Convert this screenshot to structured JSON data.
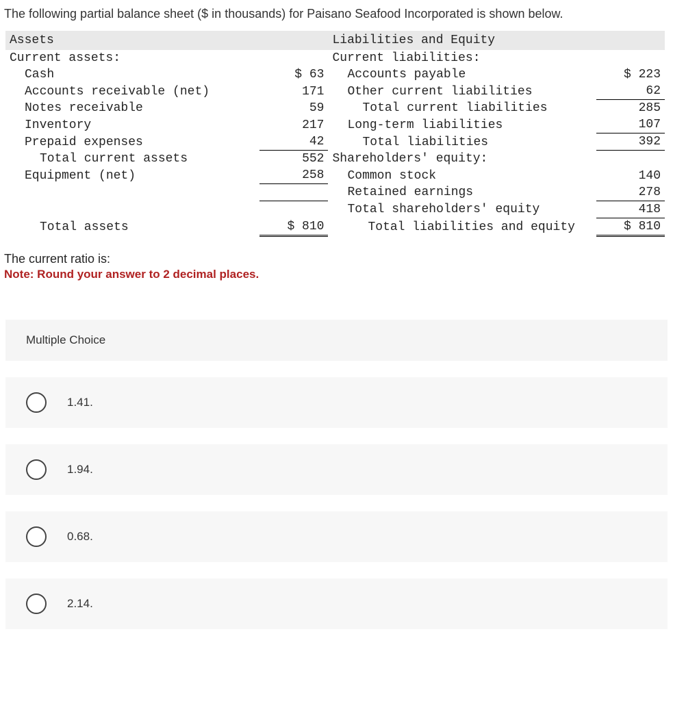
{
  "intro": "The following partial balance sheet ($ in thousands) for Paisano Seafood Incorporated is shown below.",
  "bs": {
    "left_header": "Assets",
    "right_header": "Liabilities and Equity",
    "ca_title": "Current assets:",
    "cl_title": "Current liabilities:",
    "ca": {
      "cash_label": "Cash",
      "cash_amt": "$ 63",
      "ar_label": "Accounts receivable (net)",
      "ar_amt": "171",
      "nr_label": "Notes receivable",
      "nr_amt": "59",
      "inv_label": "Inventory",
      "inv_amt": "217",
      "pp_label": "Prepaid expenses",
      "pp_amt": "42",
      "tca_label": "Total current assets",
      "tca_amt": "552",
      "eq_label": "Equipment (net)",
      "eq_amt": "258",
      "ta_label": "Total assets",
      "ta_amt": "$ 810"
    },
    "cl": {
      "ap_label": "Accounts payable",
      "ap_amt": "$ 223",
      "ocl_label": "Other current liabilities",
      "ocl_amt": "62",
      "tcl_label": "Total current liabilities",
      "tcl_amt": "285",
      "ltl_label": "Long-term liabilities",
      "ltl_amt": "107",
      "tl_label": "Total liabilities",
      "tl_amt": "392",
      "se_title": "Shareholders' equity:",
      "cs_label": "Common stock",
      "cs_amt": "140",
      "re_label": "Retained earnings",
      "re_amt": "278",
      "tse_label": "Total shareholders' equity",
      "tse_amt": "418",
      "tle_label": "Total liabilities and equity",
      "tle_amt": "$ 810"
    }
  },
  "question_text": "The current ratio is:",
  "note_text": "Note: Round your answer to 2 decimal places.",
  "mc_title": "Multiple Choice",
  "options": {
    "a": "1.41.",
    "b": "1.94.",
    "c": "0.68.",
    "d": "2.14."
  }
}
